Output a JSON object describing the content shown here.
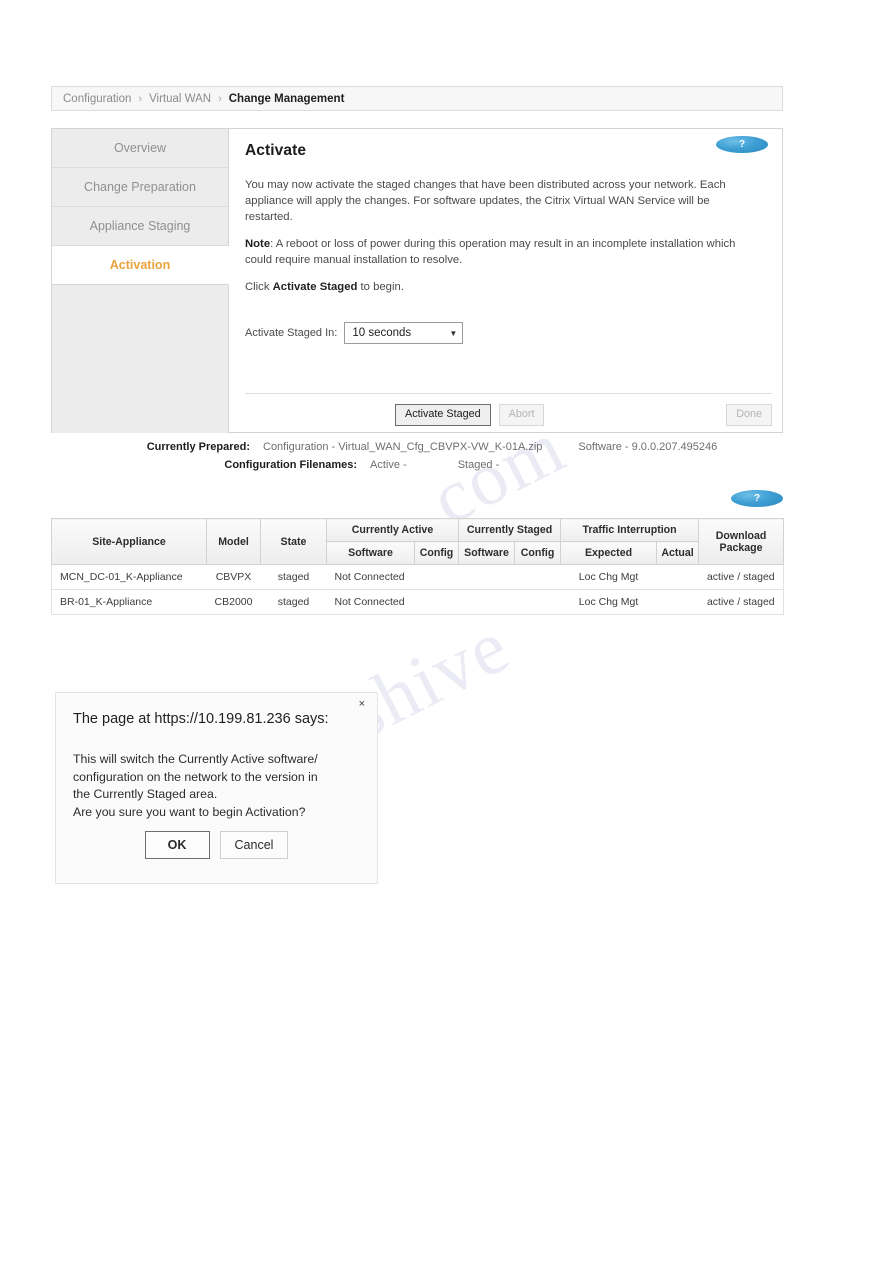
{
  "breadcrumb": {
    "items": [
      "Configuration",
      "Virtual WAN",
      "Change Management"
    ],
    "separator": "›"
  },
  "sidebar": {
    "items": [
      {
        "label": "Overview",
        "active": false
      },
      {
        "label": "Change Preparation",
        "active": false
      },
      {
        "label": "Appliance Staging",
        "active": false
      },
      {
        "label": "Activation",
        "active": true
      }
    ]
  },
  "help": {
    "glyph": "?",
    "name": "help-badge"
  },
  "main": {
    "title": "Activate",
    "paragraph1": "You may now activate the staged changes that have been distributed across your network. Each appliance will apply the changes. For software updates, the Citrix Virtual WAN Service will be restarted.",
    "note_label": "Note",
    "note_rest": ": A reboot or loss of power during this operation may result in an incomplete installation which could require manual installation to resolve.",
    "click_prefix": "Click ",
    "click_bold": "Activate Staged",
    "click_suffix": " to begin.",
    "field_label": "Activate Staged In:",
    "select_value": "10 seconds",
    "select_caret": "▼",
    "select_options": [
      "10 seconds"
    ],
    "buttons": {
      "activate": "Activate Staged",
      "abort": "Abort",
      "done": "Done"
    }
  },
  "status": {
    "prepared_label": "Currently Prepared:",
    "prepared_config": "Configuration - Virtual_WAN_Cfg_CBVPX-VW_K-01A.zip",
    "prepared_software": "Software - 9.0.0.207.495246",
    "filenames_label": "Configuration Filenames:",
    "filenames_active": "Active -",
    "filenames_staged": "Staged -"
  },
  "table": {
    "group_headers": {
      "site": "Site-Appliance",
      "model": "Model",
      "state": "State",
      "currently_active": "Currently Active",
      "currently_staged": "Currently Staged",
      "traffic_interruption": "Traffic Interruption",
      "download_package": "Download Package"
    },
    "sub_headers": {
      "active_software": "Software",
      "active_config": "Config",
      "staged_software": "Software",
      "staged_config": "Config",
      "expected": "Expected",
      "actual": "Actual"
    },
    "rows": [
      {
        "site": "MCN_DC-01_K-Appliance",
        "model": "CBVPX",
        "state": "staged",
        "currently_active": "Not Connected",
        "currently_staged": "",
        "expected": "Loc Chg Mgt",
        "actual": "",
        "download": "active / staged"
      },
      {
        "site": "BR-01_K-Appliance",
        "model": "CB2000",
        "state": "staged",
        "currently_active": "Not Connected",
        "currently_staged": "",
        "expected": "Loc Chg Mgt",
        "actual": "",
        "download": "active / staged"
      }
    ]
  },
  "dialog": {
    "title": "The page at https://10.199.81.236 says:",
    "close_glyph": "×",
    "body_line1": "This will switch the Currently Active software/",
    "body_line2": "configuration on the network to the version in",
    "body_line3": "the Currently Staged area.",
    "body_line4": "Are you sure you want to begin Activation?",
    "ok_label": "OK",
    "cancel_label": "Cancel"
  },
  "watermark": {
    "text_a": "manualshive",
    "text_b": "com"
  },
  "colors": {
    "accent_active": "#e8a33d",
    "link": "#3f8fbf",
    "help_badge": "#3f9fd4"
  }
}
